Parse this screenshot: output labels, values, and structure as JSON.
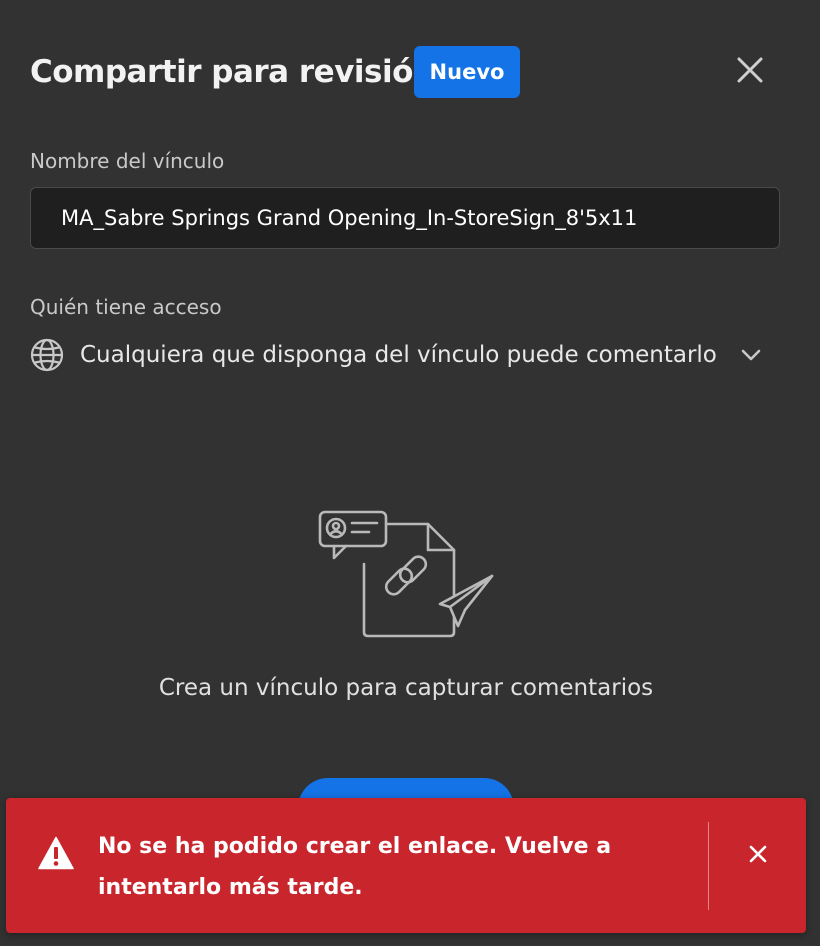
{
  "dialog": {
    "title": "Compartir para revisión",
    "badge": "Nuevo",
    "close_icon": "close-icon"
  },
  "link_name": {
    "label": "Nombre del vínculo",
    "value": "MA_Sabre Springs Grand Opening_In-StoreSign_8'5x11"
  },
  "access": {
    "label": "Quién tiene acceso",
    "icon": "globe-icon",
    "value": "Cualquiera que disponga del vínculo puede comentarlo",
    "dropdown_icon": "chevron-down-icon"
  },
  "empty_state": {
    "icon": "share-link-illustration-icon",
    "message": "Crea un vínculo para capturar comentarios"
  },
  "toast": {
    "variant": "negative",
    "icon": "alert-triangle-icon",
    "message": "No se ha podido crear el enlace. Vuelve a intentarlo más tarde.",
    "close_icon": "close-icon"
  },
  "colors": {
    "background": "#323232",
    "accent": "#1473e6",
    "error": "#c9252d",
    "input_background": "#1f1f1f"
  }
}
